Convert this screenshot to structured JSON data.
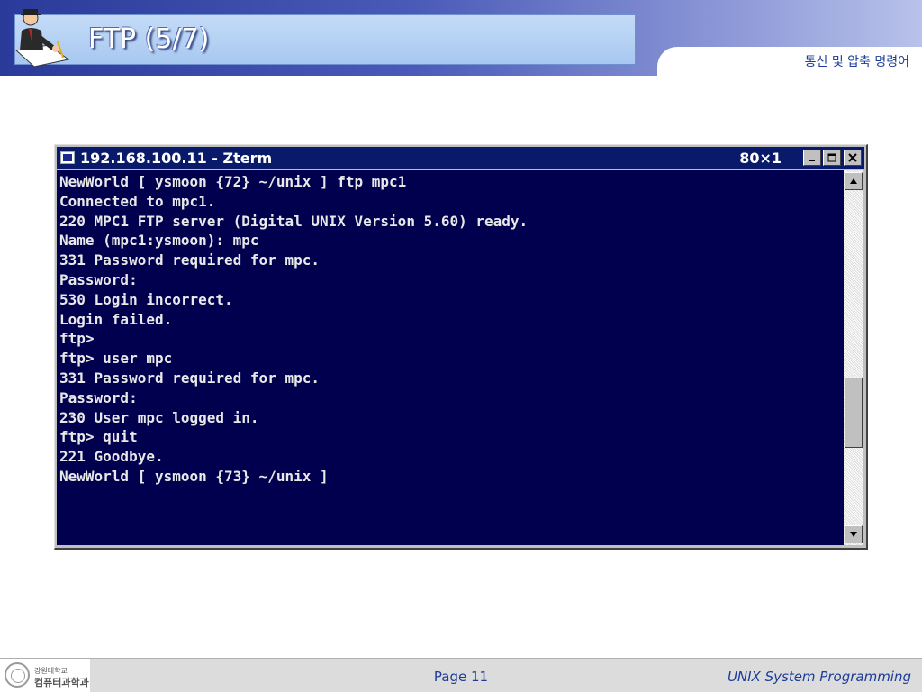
{
  "slide": {
    "title": "FTP (5/7)",
    "subtitle": "통신 및 압축 명령어"
  },
  "terminal": {
    "window_title": "192.168.100.11 - Zterm",
    "size_label": "80×1",
    "lines": [
      "NewWorld [ ysmoon {72} ~/unix ] ftp mpc1",
      "Connected to mpc1.",
      "220 MPC1 FTP server (Digital UNIX Version 5.60) ready.",
      "Name (mpc1:ysmoon): mpc",
      "331 Password required for mpc.",
      "Password:",
      "530 Login incorrect.",
      "Login failed.",
      "ftp>",
      "ftp> user mpc",
      "331 Password required for mpc.",
      "Password:",
      "230 User mpc logged in.",
      "ftp> quit",
      "221 Goodbye.",
      "NewWorld [ ysmoon {73} ~/unix ]"
    ]
  },
  "footer": {
    "university": "강원대학교",
    "department": "컴퓨터과학과",
    "page": "Page 11",
    "course": "UNIX System Programming"
  },
  "colors": {
    "terminal_bg": "#00004e",
    "titlebar_bg": "#0a1a6a",
    "accent_blue": "#1d3c9a"
  }
}
